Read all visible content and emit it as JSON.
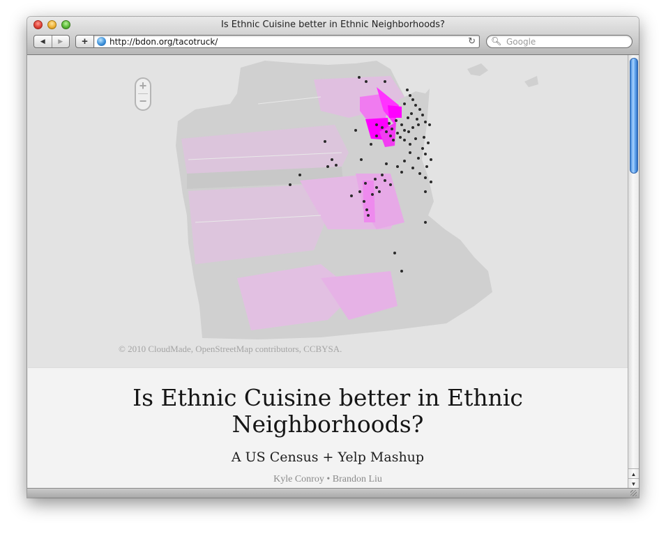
{
  "window": {
    "title": "Is Ethnic Cuisine better in Ethnic Neighborhoods?"
  },
  "toolbar": {
    "back_glyph": "◀",
    "forward_glyph": "▶",
    "add_glyph": "+",
    "url": "http://bdon.org/tacotruck/",
    "reload_glyph": "↻",
    "search_placeholder": "Google",
    "search_glyph": "🔍︎"
  },
  "map": {
    "zoom_in": "+",
    "zoom_out": "−",
    "attribution": "© 2010 CloudMade, OpenStreetMap contributors, CCBYSA.",
    "land_color": "#d2d2d2",
    "water_color": "#e3e3e3",
    "highlight_color": "#ff00ff",
    "marker_color": "#2a2a2a"
  },
  "article": {
    "title_line1": "Is Ethnic Cuisine better in Ethnic",
    "title_line2": "Neighborhoods?",
    "subtitle": "A US Census + Yelp Mashup",
    "authors": "Kyle Conroy • Brandon Liu"
  },
  "scrollbar": {
    "up_glyph": "▲",
    "down_glyph": "▼"
  }
}
